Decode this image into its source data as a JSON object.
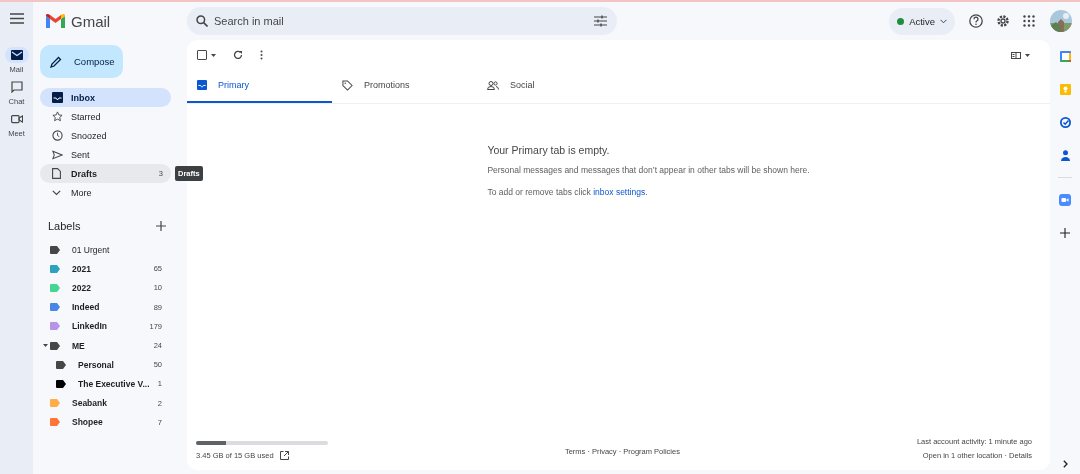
{
  "app_rail": [
    {
      "label": "Mail",
      "kind": "mail",
      "selected": true
    },
    {
      "label": "Chat",
      "kind": "chat",
      "selected": false
    },
    {
      "label": "Meet",
      "kind": "meet",
      "selected": false
    }
  ],
  "logo": {
    "text": "Gmail"
  },
  "search": {
    "placeholder": "Search in mail"
  },
  "status": {
    "label": "Active",
    "color": "#1e8e3e"
  },
  "compose": {
    "label": "Compose"
  },
  "nav": [
    {
      "label": "Inbox",
      "kind": "inbox",
      "selected": true,
      "hovered": false,
      "bold": true
    },
    {
      "label": "Starred",
      "kind": "star",
      "selected": false,
      "hovered": false,
      "bold": false
    },
    {
      "label": "Snoozed",
      "kind": "clock",
      "selected": false,
      "hovered": false,
      "bold": false
    },
    {
      "label": "Sent",
      "kind": "send",
      "selected": false,
      "hovered": false,
      "bold": false
    },
    {
      "label": "Drafts",
      "kind": "draft",
      "count": "3",
      "selected": false,
      "hovered": true,
      "bold": true,
      "tooltip": "Drafts"
    },
    {
      "label": "More",
      "kind": "more",
      "selected": false,
      "hovered": false,
      "bold": false
    }
  ],
  "labels": {
    "title": "Labels",
    "items": [
      {
        "name": "01 Urgent",
        "color": "#444746",
        "bold": false
      },
      {
        "name": "2021",
        "color": "#2da2bb",
        "count": "65",
        "bold": true
      },
      {
        "name": "2022",
        "color": "#42d692",
        "count": "10",
        "bold": true
      },
      {
        "name": "Indeed",
        "color": "#4a86e8",
        "count": "89",
        "bold": true
      },
      {
        "name": "LinkedIn",
        "color": "#b694e8",
        "count": "179",
        "bold": true
      },
      {
        "name": "ME",
        "color": "#444746",
        "count": "24",
        "bold": true,
        "expanded": true,
        "children": [
          {
            "name": "Personal",
            "color": "#444746",
            "count": "50",
            "bold": true
          },
          {
            "name": "The Executive V...",
            "color": "#000000",
            "count": "1",
            "bold": true
          }
        ]
      },
      {
        "name": "Seabank",
        "color": "#ffad47",
        "count": "2",
        "bold": true
      },
      {
        "name": "Shopee",
        "color": "#ff7537",
        "count": "7",
        "bold": true
      }
    ]
  },
  "select_all": {
    "checked": false
  },
  "tabs": [
    {
      "label": "Primary",
      "kind": "inbox",
      "selected": true
    },
    {
      "label": "Promotions",
      "kind": "tag",
      "selected": false
    },
    {
      "label": "Social",
      "kind": "people",
      "selected": false
    }
  ],
  "empty": {
    "title": "Your Primary tab is empty.",
    "body": "Personal messages and messages that don’t appear in other tabs will be shown here.",
    "hint": "To add or remove tabs click",
    "link": "inbox settings",
    "after": "."
  },
  "footer": {
    "storage": {
      "level": 0.23,
      "text": "3.45 GB of 15 GB used"
    },
    "links": "Terms · Privacy · Program Policies",
    "activity": "Last account activity: 1 minute ago",
    "details": "Open in 1 other location · Details"
  }
}
